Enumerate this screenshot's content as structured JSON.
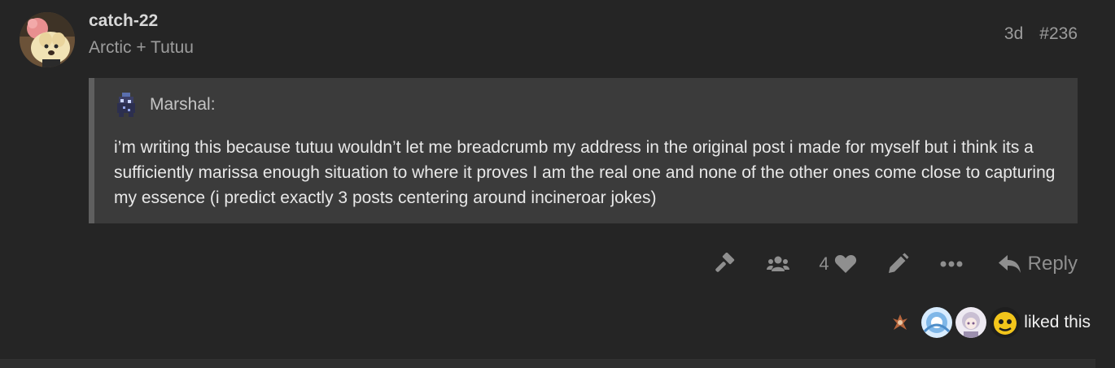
{
  "post": {
    "username": "catch-22",
    "user_title": "Arctic + Tutuu",
    "age": "3d",
    "post_number": "#236"
  },
  "quote": {
    "author": "Marshal:",
    "text": "i’m writing this because tutuu wouldn’t let me breadcrumb my address in the original post i made for myself but i think its a sufficiently marissa enough situation to where it proves I am the real one and none of the other ones come close to capturing my essence (i predict exactly 3 posts centering around incineroar jokes)"
  },
  "actions": {
    "icons": [
      "hammer-icon",
      "users-icon",
      "heart-icon",
      "pencil-icon",
      "ellipsis-icon",
      "reply-icon"
    ],
    "like_count": "4",
    "reply_label": "Reply"
  },
  "likes": {
    "liked_text": "liked this"
  },
  "colors": {
    "background": "#252525",
    "quote_background": "#3b3b3b",
    "quote_border": "#5f5f5f",
    "muted_text": "#9c9c9c",
    "icon": "#8f8f8f"
  }
}
